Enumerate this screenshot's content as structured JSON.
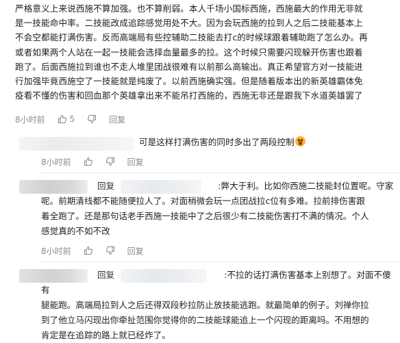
{
  "main_comment": {
    "lines": [
      "严格意义上来说西施不算加强。也不算削弱。本人千场小国标西施，西施最大的作用无非就",
      "是一技能命中率。二技能改成追踪感觉用处不大。因为会玩西施的拉到人之后二技能基本上",
      "不会空都能打满伤害。反而高端局有些控辅助二技能去打c的时候球跟着辅助跑了怎么办。再",
      "或者如果两个人站在一起一技能会选择血量最多的拉。这个时候只需要闪现躲开伤害也跟着",
      "跑了。后面西施拉到谁也不走人堆里团战很难有以前那么高输出。真正希望官方对一技能进",
      "行加强毕竟西施空了一技能就是纯废了。以前西施确实强。但是随着版本出的新英雄霸体免",
      "疫看不懂的伤害和回血那个英雄拿出来不能吊打西施的，西施无非还是跟我下水道英雄罢了"
    ],
    "time": "8小时前",
    "likes": "5",
    "reply_label": "回复"
  },
  "replies": [
    {
      "lines": [
        "可是这样打满伤害的同时多出了两段控制"
      ],
      "time": "8小时前",
      "reply_label": "回复"
    },
    {
      "prefix": "回复",
      "lines": [
        ":弊大于利。比如你西施二技能封位置呢。守家",
        "呢。前期清线都不能随便拉人了。对面稍微会玩一点团战拉c位有多难。拉前排伤害跟",
        "着全跑了。还是那句话老手西施一技能中了之后很少有二技能伤害打不满的情况。个人",
        "感觉真的不如不改"
      ],
      "time": "8小时前",
      "reply_label": "回复"
    },
    {
      "prefix": "回复",
      "lines": [
        ":不拉的话打满伤害基本上别想了。对面不傻有",
        "腿能跑。高端局拉到人之后还得双段秒拉防止放技能逃跑。就最简单的例子。刘禅你拉",
        "到了他立马闪现出你牵扯范围你觉得你的二技能球能追上一个闪现的距离吗。不用想的",
        "肯定是在追踪的路上就已经炸了。"
      ]
    }
  ]
}
